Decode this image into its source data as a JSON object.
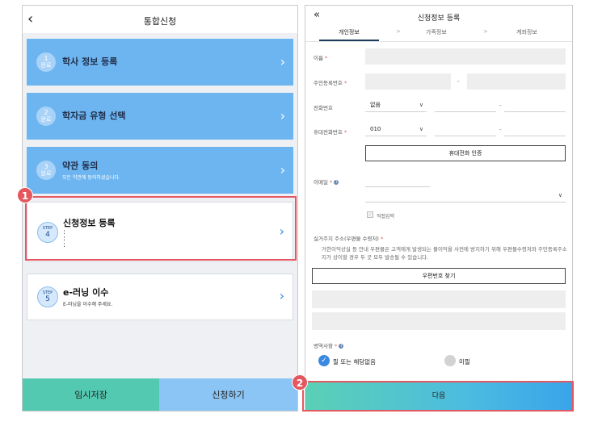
{
  "left": {
    "back_icon": "chevron-left-icon",
    "title": "통합신청",
    "cards": [
      {
        "step": "1",
        "status": "완료",
        "title": "학사 정보 등록",
        "subtitle": ""
      },
      {
        "step": "2",
        "status": "완료",
        "title": "학자금 유형 선택",
        "subtitle": ""
      },
      {
        "step": "3",
        "status": "완료",
        "title": "약관 동의",
        "subtitle": "모든 약관에 동의하셨습니다."
      }
    ],
    "current_card": {
      "step_label": "STEP",
      "step": "4",
      "title": "신청정보 등록",
      "lines": [
        ":",
        ":",
        ":"
      ]
    },
    "next_card": {
      "step_label": "STEP",
      "step": "5",
      "title": "e-러닝 이수",
      "subtitle": "E-러닝을 이수해 주세요."
    },
    "save_button": "임시저장",
    "apply_button": "신청하기"
  },
  "badges": {
    "one": "1",
    "two": "2"
  },
  "right": {
    "back_icon": "double-chevron-left-icon",
    "title": "신청정보 등록",
    "tabs": [
      "개인정보",
      "가족정보",
      "계좌정보"
    ],
    "active_tab": 0,
    "fields": {
      "name_label": "이름",
      "rrn_label": "주민등록번호",
      "phone_label": "전화번호",
      "phone_area": "없음",
      "mobile_label": "휴대전화번호",
      "mobile_prefix": "010",
      "verify_button": "휴대전화 인증",
      "email_label": "이메일",
      "direct_input": "직접입력",
      "address_label": "실거주지 주소(우편물 수령처)",
      "address_note": "거한이익상실 등 안내 우편물은 고객에게 발생되는 불이익을 사전에 방지하기 위해 우편물수령처와 주민등록주소지가 상이할 경우 두 곳 모두 발송될 수 있습니다.",
      "zip_button": "우편번호 찾기",
      "military_label": "병역사항",
      "military_options": [
        "필 또는 해당없음",
        "미필"
      ],
      "military_selected": 0
    },
    "next_button": "다음",
    "colors": {
      "accent": "#3a89e0",
      "highlight": "#e45861"
    }
  }
}
